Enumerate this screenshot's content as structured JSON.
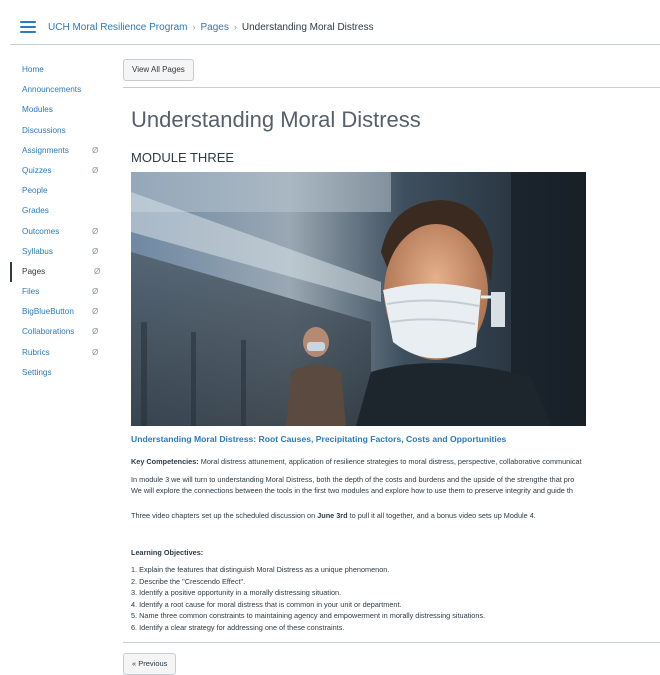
{
  "breadcrumb": {
    "course": "UCH Moral Resilience Program",
    "section": "Pages",
    "current": "Understanding Moral Distress",
    "separator": "›"
  },
  "sidebar": {
    "items": [
      {
        "label": "Home",
        "hidden_icon": false
      },
      {
        "label": "Announcements",
        "hidden_icon": false
      },
      {
        "label": "Modules",
        "hidden_icon": false
      },
      {
        "label": "Discussions",
        "hidden_icon": false
      },
      {
        "label": "Assignments",
        "hidden_icon": true
      },
      {
        "label": "Quizzes",
        "hidden_icon": true
      },
      {
        "label": "People",
        "hidden_icon": false
      },
      {
        "label": "Grades",
        "hidden_icon": false
      },
      {
        "label": "Outcomes",
        "hidden_icon": true
      },
      {
        "label": "Syllabus",
        "hidden_icon": true
      },
      {
        "label": "Pages",
        "hidden_icon": true,
        "active": true
      },
      {
        "label": "Files",
        "hidden_icon": true
      },
      {
        "label": "BigBlueButton",
        "hidden_icon": true
      },
      {
        "label": "Collaborations",
        "hidden_icon": true
      },
      {
        "label": "Rubrics",
        "hidden_icon": true
      },
      {
        "label": "Settings",
        "hidden_icon": false
      }
    ],
    "hidden_icon_glyph": "Ø"
  },
  "main": {
    "view_all_label": "View All Pages",
    "title": "Understanding Moral Distress",
    "module_heading": "MODULE THREE",
    "subheading": "Understanding Moral Distress: Root Causes, Precipitating Factors, Costs and Opportunities",
    "competencies_label": "Key Competencies:",
    "competencies_text": " Moral distress attunement, application of resilience strategies to moral distress, perspective, collaborative communicat",
    "intro_line1": "In module 3 we will turn to understanding Moral Distress, both the depth of the costs and burdens and the upside of the strengthe that pro",
    "intro_line2": "We will explore the connections between the tools in the first two modules and explore how to use them to preserve integrity and guide th",
    "video_text_before": "Three video chapters set up the scheduled discussion on ",
    "video_date": "June 3rd",
    "video_text_after": " to pull it all together, and a bonus video sets up Module 4.",
    "objectives_label": "Learning Objectives:",
    "objectives": [
      "1. Explain the features that distinguish Moral Distress as a unique phenomenon.",
      "2. Describe the \"Crescendo Effect\".",
      "3. Identify a positive opportunity in a morally distressing situation.",
      "4. Identify a root cause for moral distress that is common in your unit or department.",
      "5. Name three common constraints to maintaining agency and empowerment in morally distressing situations.",
      "6. Identify a clear strategy for addressing one of these constraints."
    ],
    "previous_label": "« Previous"
  },
  "colors": {
    "link": "#2b7abc",
    "text": "#2d3b45",
    "border": "#c7cdd1"
  }
}
